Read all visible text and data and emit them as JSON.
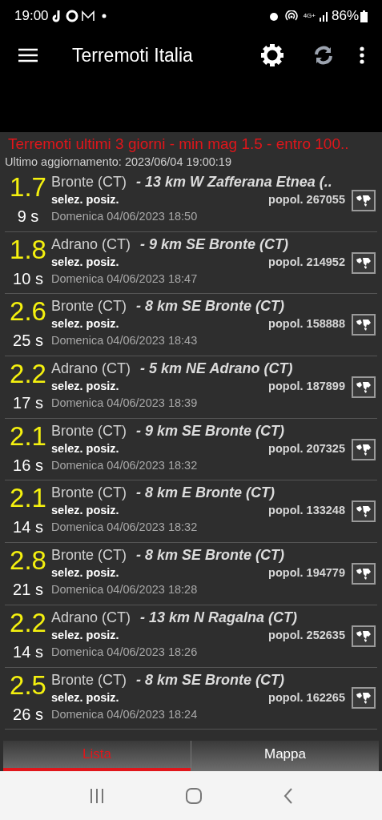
{
  "status_bar": {
    "time": "19:00",
    "battery": "86%",
    "network": "4G+"
  },
  "app_bar": {
    "title": "Terremoti Italia"
  },
  "header": {
    "title": "Terremoti ultimi 3 giorni  - min mag 1.5 - entro 100..",
    "updated": "Ultimo aggiornamento: 2023/06/04 19:00:19"
  },
  "quakes": [
    {
      "magnitude": "1.7",
      "ago": "9 s",
      "place": "Bronte (CT)",
      "distance": "- 13 km W Zafferana Etnea (..",
      "select": "selez. posiz.",
      "population": "popol. 267055",
      "date": "Domenica 04/06/2023 18:50"
    },
    {
      "magnitude": "1.8",
      "ago": "10 s",
      "place": "Adrano (CT)",
      "distance": "- 9 km SE Bronte (CT)",
      "select": "selez. posiz.",
      "population": "popol. 214952",
      "date": "Domenica 04/06/2023 18:47"
    },
    {
      "magnitude": "2.6",
      "ago": "25 s",
      "place": "Bronte (CT)",
      "distance": "- 8 km SE Bronte (CT)",
      "select": "selez. posiz.",
      "population": "popol. 158888",
      "date": "Domenica 04/06/2023 18:43"
    },
    {
      "magnitude": "2.2",
      "ago": "17 s",
      "place": "Adrano (CT)",
      "distance": "- 5 km NE Adrano (CT)",
      "select": "selez. posiz.",
      "population": "popol. 187899",
      "date": "Domenica 04/06/2023 18:39"
    },
    {
      "magnitude": "2.1",
      "ago": "16 s",
      "place": "Bronte (CT)",
      "distance": "- 9 km SE Bronte (CT)",
      "select": "selez. posiz.",
      "population": "popol. 207325",
      "date": "Domenica 04/06/2023 18:32"
    },
    {
      "magnitude": "2.1",
      "ago": "14 s",
      "place": "Bronte (CT)",
      "distance": "- 8 km E Bronte (CT)",
      "select": "selez. posiz.",
      "population": "popol. 133248",
      "date": "Domenica 04/06/2023 18:32"
    },
    {
      "magnitude": "2.8",
      "ago": "21 s",
      "place": "Bronte (CT)",
      "distance": "- 8 km SE Bronte (CT)",
      "select": "selez. posiz.",
      "population": "popol. 194779",
      "date": "Domenica 04/06/2023 18:28"
    },
    {
      "magnitude": "2.2",
      "ago": "14 s",
      "place": "Adrano (CT)",
      "distance": "- 13 km N Ragalna (CT)",
      "select": "selez. posiz.",
      "population": "popol. 252635",
      "date": "Domenica 04/06/2023 18:26"
    },
    {
      "magnitude": "2.5",
      "ago": "26 s",
      "place": "Bronte (CT)",
      "distance": "- 8 km SE Bronte (CT)",
      "select": "selez. posiz.",
      "population": "popol. 162265",
      "date": "Domenica 04/06/2023 18:24"
    }
  ],
  "tabs": [
    {
      "label": "Lista",
      "selected": true
    },
    {
      "label": "Mappa",
      "selected": false
    }
  ]
}
